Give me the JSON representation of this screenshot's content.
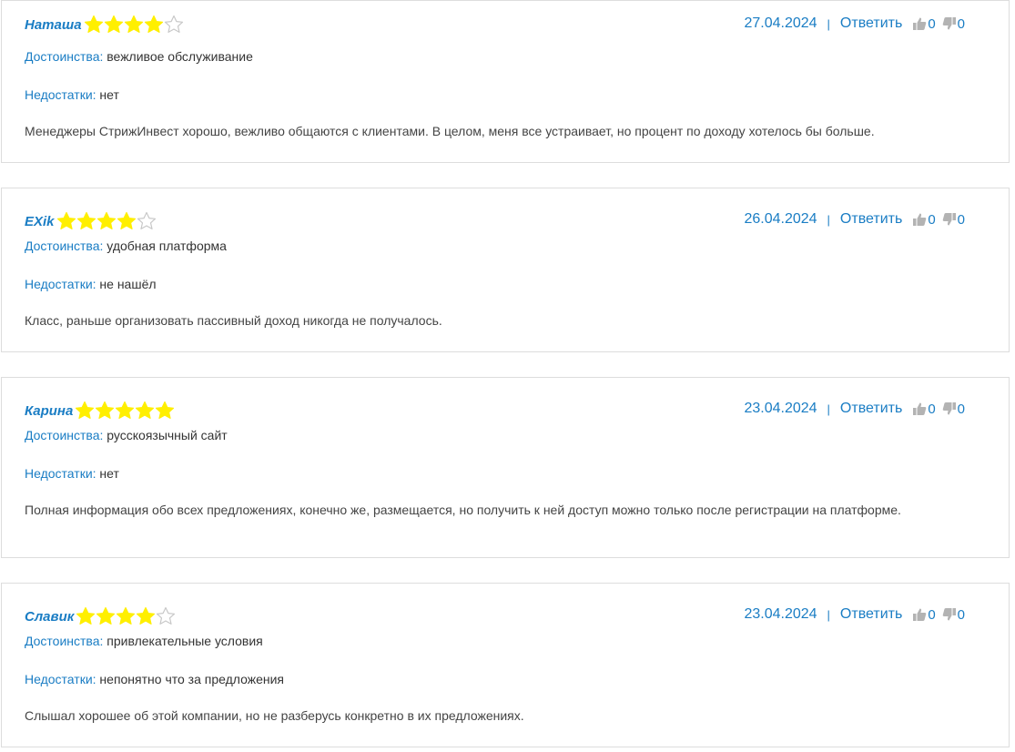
{
  "labels": {
    "pros": "Достоинства:",
    "cons": "Недостатки:",
    "reply": "Ответить",
    "separator": "|"
  },
  "colors": {
    "accent": "#1a7dc4",
    "star_filled": "#ffef00",
    "star_empty": "#c8c8c8",
    "border": "#dddddd",
    "vote_icon": "#b3b3b3"
  },
  "icons": {
    "star": "star-icon",
    "like": "thumbs-up-icon",
    "dislike": "thumbs-down-icon"
  },
  "reviews": [
    {
      "author": "Наташа",
      "rating": 4,
      "date": "27.04.2024",
      "likes": "0",
      "dislikes": "0",
      "pros": "вежливое обслуживание",
      "cons": "нет",
      "text": "Менеджеры СтрижИнвест хорошо, вежливо общаются с клиентами. В целом, меня все устраивает, но процент по доходу хотелось бы больше."
    },
    {
      "author": "EXik",
      "rating": 4,
      "date": "26.04.2024",
      "likes": "0",
      "dislikes": "0",
      "pros": "удобная платформа",
      "cons": "не нашёл",
      "text": "Класс, раньше организовать пассивный доход никогда не получалось."
    },
    {
      "author": "Карина",
      "rating": 5,
      "date": "23.04.2024",
      "likes": "0",
      "dislikes": "0",
      "pros": "русскоязычный сайт",
      "cons": "нет",
      "text": "Полная информация обо всех предложениях, конечно же, размещается, но получить к ней доступ можно только после регистрации на платформе."
    },
    {
      "author": "Славик",
      "rating": 4,
      "date": "23.04.2024",
      "likes": "0",
      "dislikes": "0",
      "pros": "привлекательные условия",
      "cons": "непонятно что за предложения",
      "text": "Слышал хорошее об этой компании, но не разберусь конкретно в их предложениях."
    }
  ]
}
